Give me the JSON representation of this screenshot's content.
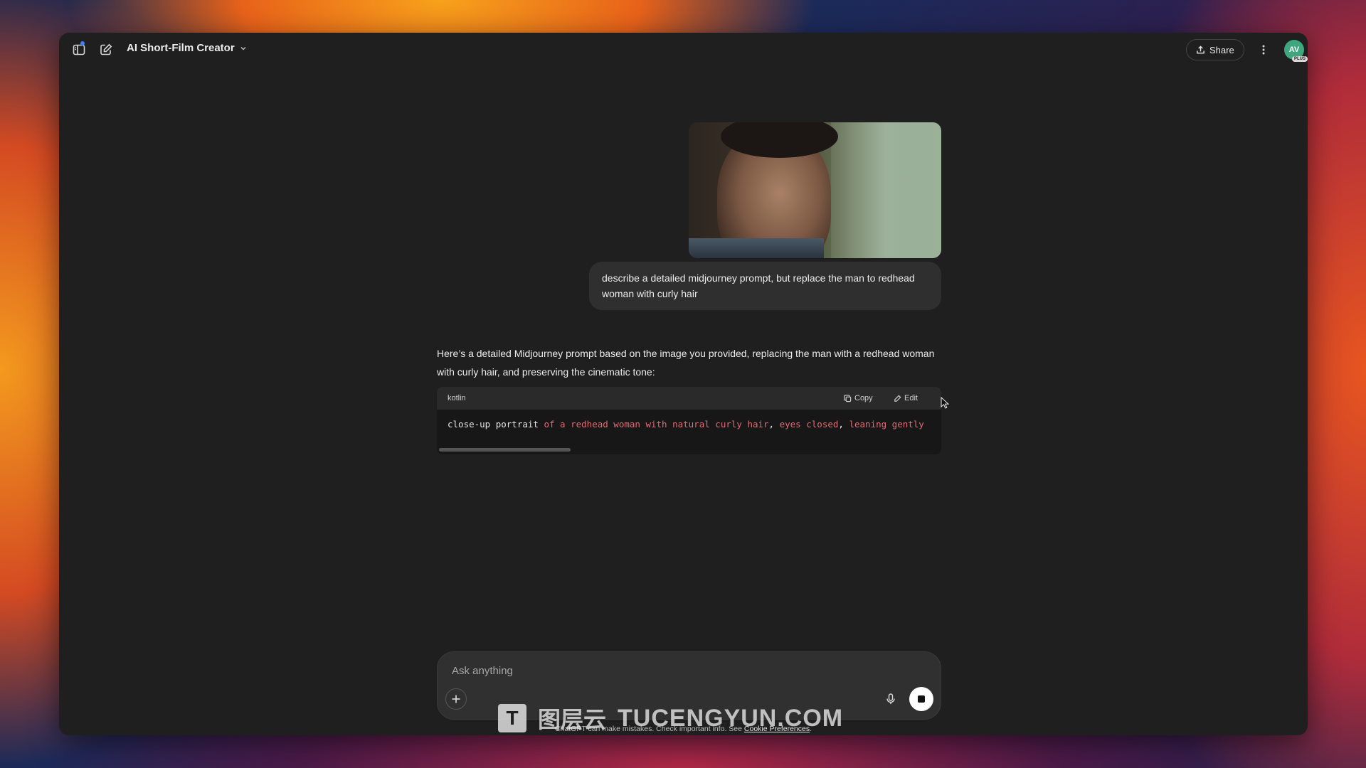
{
  "header": {
    "title": "AI Short-Film Creator",
    "share_label": "Share",
    "avatar_initials": "AV",
    "avatar_badge": "PLUS"
  },
  "conversation": {
    "user_message": "describe a detailed midjourney prompt, but replace the man to redhead woman with curly hair",
    "assistant_intro": "Here’s a detailed Midjourney prompt based on the image you provided, replacing the man with a redhead woman with curly hair, and preserving the cinematic tone:",
    "code_block": {
      "language": "kotlin",
      "copy_label": "Copy",
      "edit_label": "Edit",
      "code_plain": "close-up portrait ",
      "code_string_1": "of a redhead woman with natural curly hair",
      "code_sep_1": ", ",
      "code_string_2": "eyes closed",
      "code_sep_2": ", ",
      "code_string_3": "leaning gently"
    }
  },
  "composer": {
    "placeholder": "Ask anything"
  },
  "footer": {
    "disclaimer_text": "ChatGPT can make mistakes. Check important info. See ",
    "disclaimer_link": "Cookie Preferences",
    "disclaimer_end": "."
  },
  "watermark": {
    "cn": "图层云",
    "en": "TUCENGYUN.COM",
    "logo_letter": "T"
  },
  "colors": {
    "background": "#1f1f1f",
    "bubble": "#303030",
    "code_string": "#e06c75",
    "avatar": "#3fa77e"
  }
}
